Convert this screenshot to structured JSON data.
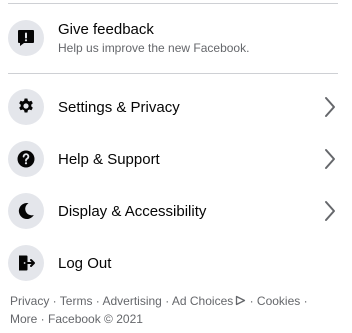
{
  "menu": {
    "feedback": {
      "label": "Give feedback",
      "sublabel": "Help us improve the new Facebook."
    },
    "settings": {
      "label": "Settings & Privacy"
    },
    "help": {
      "label": "Help & Support"
    },
    "display": {
      "label": "Display & Accessibility"
    },
    "logout": {
      "label": "Log Out"
    }
  },
  "footer": {
    "privacy": "Privacy",
    "terms": "Terms",
    "advertising": "Advertising",
    "ad_choices": "Ad Choices",
    "cookies": "Cookies",
    "more": "More",
    "copyright": "Facebook © 2021",
    "separator": " · "
  },
  "colors": {
    "icon_bg": "#e4e6eb",
    "text_primary": "#050505",
    "text_secondary": "#65676b",
    "divider": "#ced0d4"
  },
  "icons": {
    "feedback": "exclamation-bubble-icon",
    "settings": "gear-icon",
    "help": "question-icon",
    "display": "moon-icon",
    "logout": "door-exit-icon",
    "chevron": "chevron-right-icon"
  }
}
